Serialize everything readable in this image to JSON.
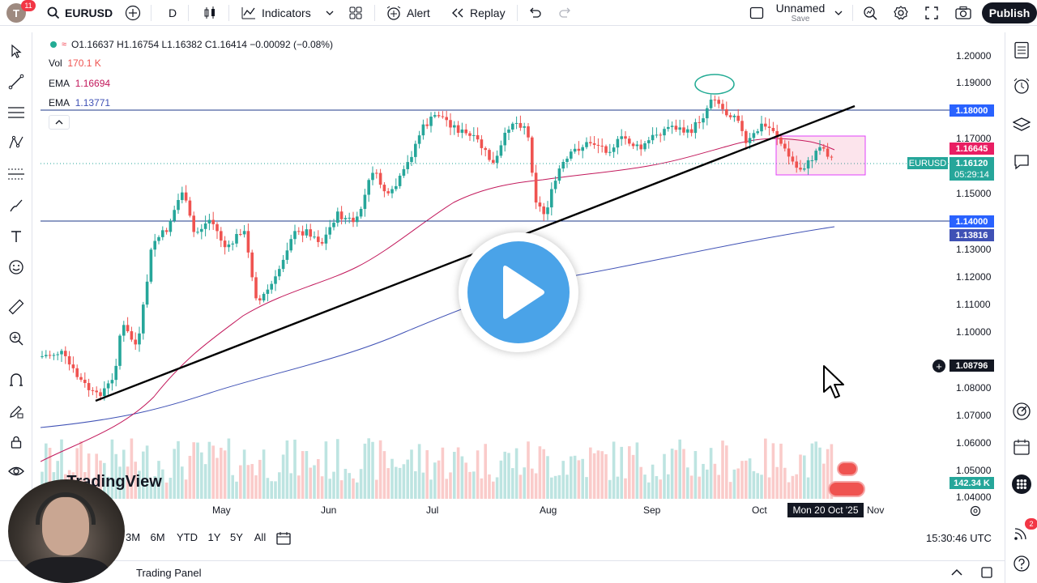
{
  "topbar": {
    "avatar_letter": "T",
    "notification_count": "11",
    "symbol": "EURUSD",
    "interval": "D",
    "indicators_label": "Indicators",
    "alert_label": "Alert",
    "replay_label": "Replay",
    "layout_name": "Unnamed",
    "layout_status": "Save",
    "publish_label": "Publish"
  },
  "legend": {
    "ohlc": "O1.16637 H1.16754 L1.16382 C1.16414 −0.00092 (−0.08%)",
    "vol_label": "Vol",
    "vol_value": "170.1 K",
    "ema1_label": "EMA",
    "ema1_value": "1.16694",
    "ema2_label": "EMA",
    "ema2_value": "1.13771"
  },
  "price_axis": {
    "ticks": [
      "1.20000",
      "1.19000",
      "1.17000",
      "1.15000",
      "1.13000",
      "1.12000",
      "1.11000",
      "1.10000",
      "1.08000",
      "1.07000",
      "1.06000",
      "1.05000",
      "1.04000"
    ],
    "level_upper": "1.18000",
    "ema_fast": "1.16645",
    "symbol_tag": "EURUSD",
    "last_price": "1.16120",
    "countdown": "05:29:14",
    "level_lower": "1.14000",
    "ema_slow": "1.13816",
    "crosshair": "1.08796",
    "volume": "142.34 K"
  },
  "time_axis": {
    "labels": [
      "May",
      "Jun",
      "Jul",
      "Aug",
      "Sep",
      "Oct",
      "Nov"
    ],
    "crosshair_date": "Mon 20 Oct '25"
  },
  "watermark": "TradingView",
  "bottom": {
    "ranges": [
      "3M",
      "6M",
      "YTD",
      "1Y",
      "5Y",
      "All"
    ],
    "clock": "15:30:46 UTC",
    "trading_panel": "Trading Panel"
  },
  "rightbar": {
    "notification_count": "2"
  },
  "colors": {
    "up": "#26a69a",
    "down": "#ef5350",
    "ema_fast": "#c2185b",
    "ema_slow": "#3f51b5",
    "play": "#4aa3e8",
    "level_upper_bg": "#2962ff",
    "ema_fast_bg": "#e91e63",
    "ema_slow_bg": "#3f51b5",
    "last_price_bg": "#26a69a"
  }
}
